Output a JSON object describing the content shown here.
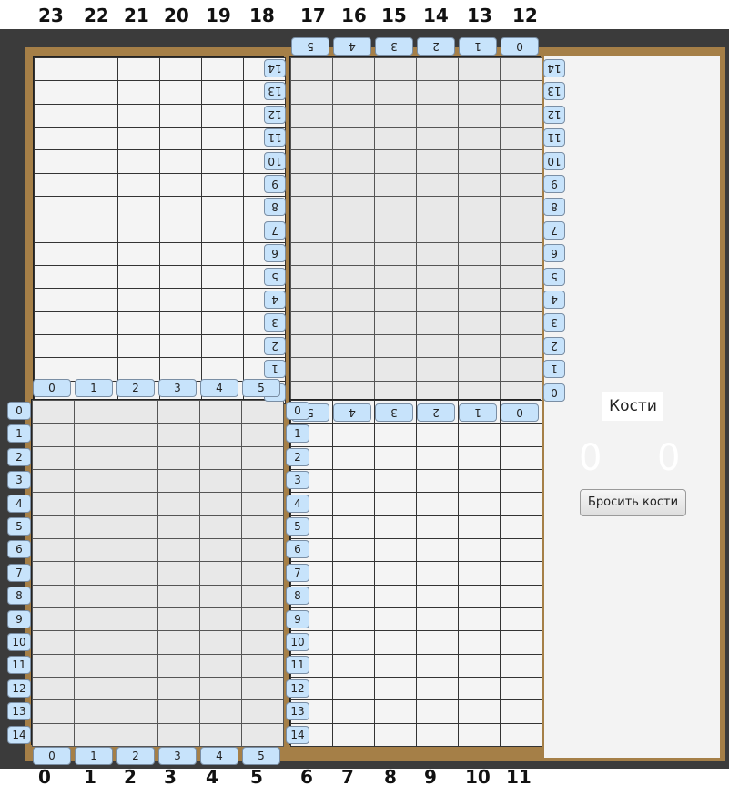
{
  "top_points": [
    "23",
    "22",
    "21",
    "20",
    "19",
    "18",
    "17",
    "16",
    "15",
    "14",
    "13",
    "12"
  ],
  "bottom_points": [
    "0",
    "1",
    "2",
    "3",
    "4",
    "5",
    "6",
    "7",
    "8",
    "9",
    "10",
    "11"
  ],
  "col_indices": [
    "0",
    "1",
    "2",
    "3",
    "4",
    "5"
  ],
  "row_indices": [
    "0",
    "1",
    "2",
    "3",
    "4",
    "5",
    "6",
    "7",
    "8",
    "9",
    "10",
    "11",
    "12",
    "13",
    "14"
  ],
  "dice": {
    "title": "Кости",
    "values": [
      "0",
      "0"
    ],
    "roll_button": "Бросить кости"
  }
}
